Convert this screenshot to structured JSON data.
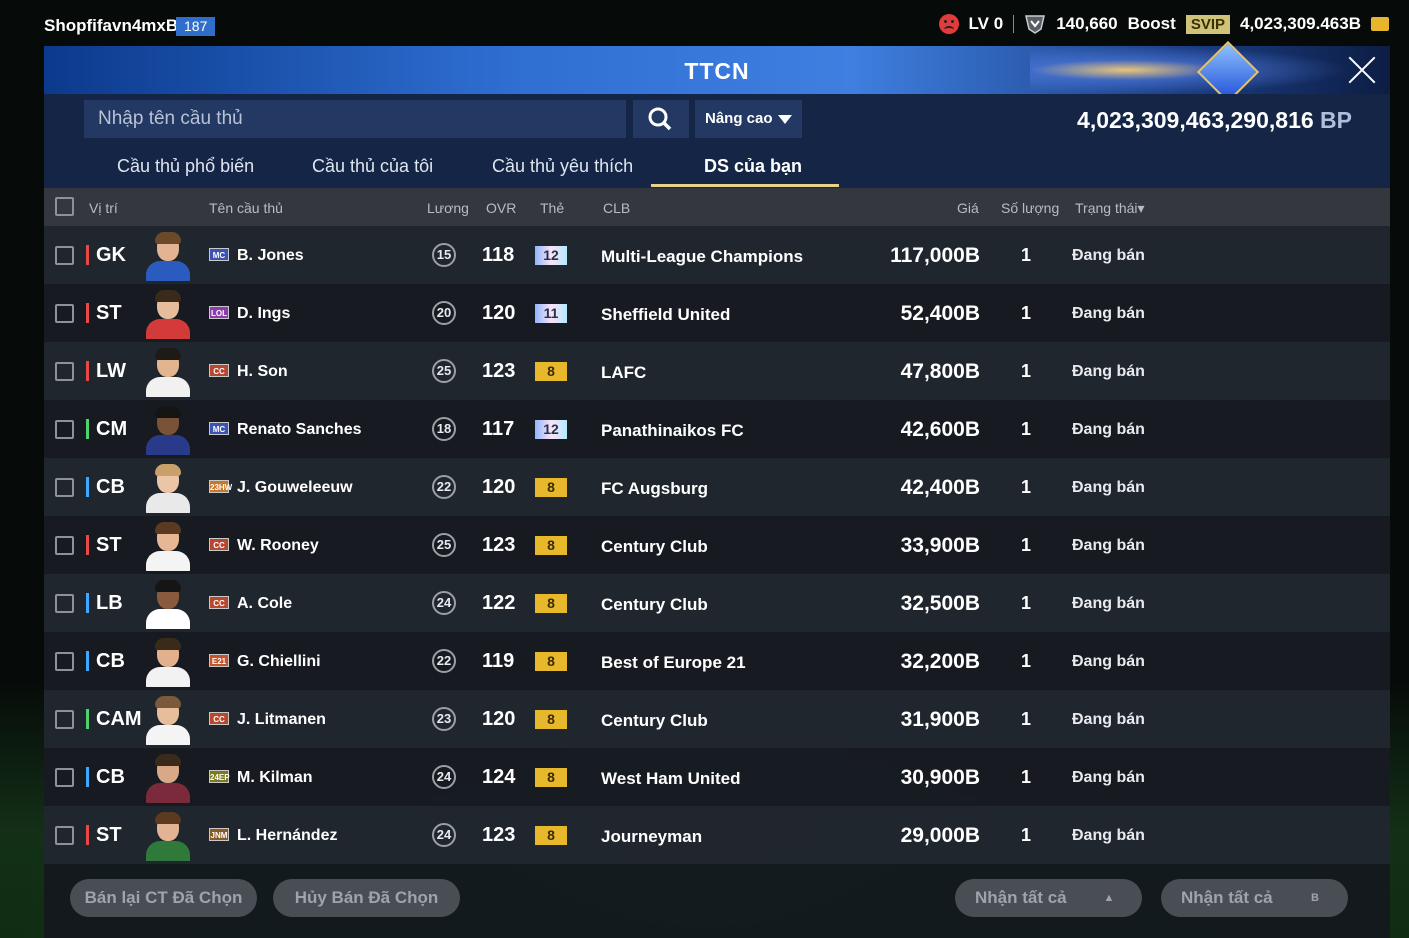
{
  "user": {
    "name": "Shopfifavn4mxBs",
    "level": "187"
  },
  "topbar": {
    "lv": "LV 0",
    "trophies": "140,660",
    "boost": "Boost",
    "svip": "SVIP",
    "balance": "4,023,309.463B"
  },
  "panel": {
    "title": "TTCN",
    "search_placeholder": "Nhập tên cầu thủ",
    "advanced": "Nâng cao",
    "bp_value": "4,023,309,463,290,816",
    "bp_unit": "BP",
    "tabs": [
      "Cầu thủ phổ biến",
      "Cầu thủ của tôi",
      "Cầu thủ yêu thích",
      "DS của bạn"
    ],
    "active_tab": "DS của bạn",
    "columns": {
      "position": "Vị trí",
      "name": "Tên cầu thủ",
      "wage": "Lương",
      "ovr": "OVR",
      "card": "Thẻ",
      "club": "CLB",
      "price": "Giá",
      "qty": "Số lượng",
      "status": "Trạng thái▾"
    }
  },
  "players": [
    {
      "pos": "GK",
      "pos_color": "red",
      "season": "MC",
      "season_color": "#3b53b5",
      "name": "B. Jones",
      "wage": "15",
      "ovr": "118",
      "grade": "12",
      "grade_type": "silver",
      "club": "Multi-League Champions",
      "price": "117,000B",
      "qty": "1",
      "status": "Đang bán"
    },
    {
      "pos": "ST",
      "pos_color": "red",
      "season": "LOL",
      "season_color": "#8b3dab",
      "name": "D. Ings",
      "wage": "20",
      "ovr": "120",
      "grade": "11",
      "grade_type": "silver",
      "club": "Sheffield United",
      "price": "52,400B",
      "qty": "1",
      "status": "Đang bán"
    },
    {
      "pos": "LW",
      "pos_color": "red",
      "season": "CC",
      "season_color": "#b5482e",
      "name": "H. Son",
      "wage": "25",
      "ovr": "123",
      "grade": "8",
      "grade_type": "gold",
      "club": "LAFC",
      "price": "47,800B",
      "qty": "1",
      "status": "Đang bán"
    },
    {
      "pos": "CM",
      "pos_color": "green",
      "season": "MC",
      "season_color": "#3b53b5",
      "name": "Renato Sanches",
      "wage": "18",
      "ovr": "117",
      "grade": "12",
      "grade_type": "silver",
      "club": "Panathinaikos FC",
      "price": "42,600B",
      "qty": "1",
      "status": "Đang bán"
    },
    {
      "pos": "CB",
      "pos_color": "blue",
      "season": "23HW",
      "season_color": "#c7762a",
      "name": "J. Gouweleeuw",
      "wage": "22",
      "ovr": "120",
      "grade": "8",
      "grade_type": "gold",
      "club": "FC Augsburg",
      "price": "42,400B",
      "qty": "1",
      "status": "Đang bán"
    },
    {
      "pos": "ST",
      "pos_color": "red",
      "season": "CC",
      "season_color": "#b5482e",
      "name": "W. Rooney",
      "wage": "25",
      "ovr": "123",
      "grade": "8",
      "grade_type": "gold",
      "club": "Century Club",
      "price": "33,900B",
      "qty": "1",
      "status": "Đang bán"
    },
    {
      "pos": "LB",
      "pos_color": "blue",
      "season": "CC",
      "season_color": "#b5482e",
      "name": "A. Cole",
      "wage": "24",
      "ovr": "122",
      "grade": "8",
      "grade_type": "gold",
      "club": "Century Club",
      "price": "32,500B",
      "qty": "1",
      "status": "Đang bán"
    },
    {
      "pos": "CB",
      "pos_color": "blue",
      "season": "E21",
      "season_color": "#c2552b",
      "name": "G. Chiellini",
      "wage": "22",
      "ovr": "119",
      "grade": "8",
      "grade_type": "gold",
      "club": "Best of Europe 21",
      "price": "32,200B",
      "qty": "1",
      "status": "Đang bán"
    },
    {
      "pos": "CAM",
      "pos_color": "green",
      "season": "CC",
      "season_color": "#b5482e",
      "name": "J. Litmanen",
      "wage": "23",
      "ovr": "120",
      "grade": "8",
      "grade_type": "gold",
      "club": "Century Club",
      "price": "31,900B",
      "qty": "1",
      "status": "Đang bán"
    },
    {
      "pos": "CB",
      "pos_color": "blue",
      "season": "24EP",
      "season_color": "#7a7a1e",
      "name": "M. Kilman",
      "wage": "24",
      "ovr": "124",
      "grade": "8",
      "grade_type": "gold",
      "club": "West Ham United",
      "price": "30,900B",
      "qty": "1",
      "status": "Đang bán"
    },
    {
      "pos": "ST",
      "pos_color": "red",
      "season": "JNM",
      "season_color": "#8a5a2a",
      "name": "L. Hernández",
      "wage": "24",
      "ovr": "123",
      "grade": "8",
      "grade_type": "gold",
      "club": "Journeyman",
      "price": "29,000B",
      "qty": "1",
      "status": "Đang bán"
    }
  ],
  "footer": {
    "resell": "Bán lại CT Đã Chọn",
    "cancel": "Hủy Bán Đã Chọn",
    "claim_players": "Nhận tất cả",
    "claim_bp": "Nhận tất cả"
  },
  "colors": {
    "accent_tab_line": "#e5d38a",
    "header_blue": "#2f6fd2"
  }
}
